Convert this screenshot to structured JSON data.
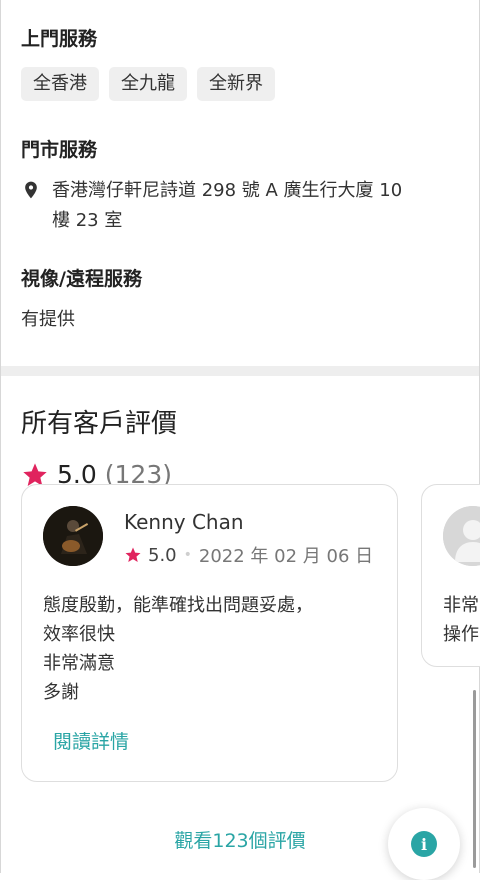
{
  "onsite_service": {
    "title": "上門服務",
    "areas": [
      "全香港",
      "全九龍",
      "全新界"
    ]
  },
  "store_service": {
    "title": "門市服務",
    "address_line1": "香港灣仔軒尼詩道 298 號 A 廣生行大廈 10",
    "address_line2": "樓 23 室"
  },
  "remote_service": {
    "title": "視像/遠程服務",
    "value": "有提供"
  },
  "reviews": {
    "title": "所有客戶評價",
    "average": "5.0",
    "count": "(123)",
    "items": [
      {
        "name": "Kenny Chan",
        "rating": "5.0",
        "date": "2022 年 02 月 06 日",
        "lines": [
          "態度殷勤，能準確找出問題妥處，",
          "效率很快",
          "非常滿意",
          "多謝"
        ],
        "read_more": "閱讀詳情"
      },
      {
        "lines": [
          "非常",
          "操作"
        ]
      }
    ],
    "view_all": "觀看123個評價"
  },
  "colors": {
    "accent": "#2aa5a5",
    "star": "#e0245e",
    "chip_bg": "#efefef",
    "divider": "#eeeeee"
  },
  "icons": {
    "location": "location-pin-icon",
    "star": "star-icon",
    "info": "info-icon"
  }
}
